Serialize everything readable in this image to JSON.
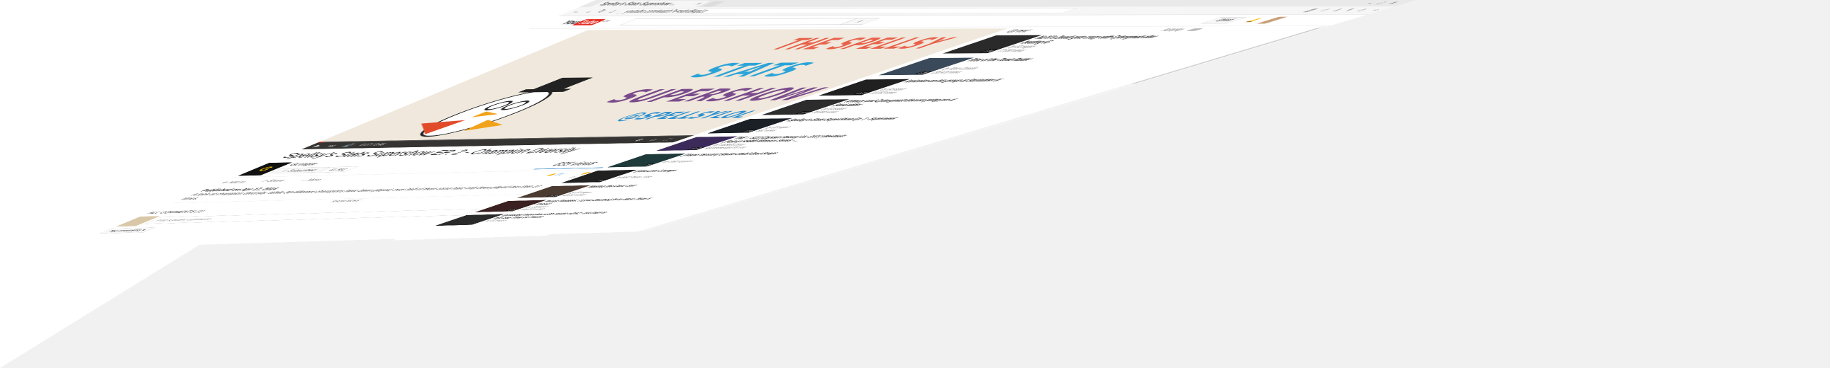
{
  "browser": {
    "tab_title": "Spellsy's Stats Supershow ...",
    "tab_close": "×",
    "url": "youtube.com/watch?v=sdrc8kqaLe"
  },
  "youtube": {
    "logo_you": "You",
    "logo_tube": "Tube",
    "logo_sup": "CA",
    "upload_label": "Upload"
  },
  "video": {
    "artwork": {
      "line1": "THE SPELLSY",
      "line2": "STATS",
      "line3": "SUPERSHOW",
      "handle": "@SPELLSYLOL"
    },
    "time": "0:17 / 3:45",
    "title": "Spellsy's Stats Supershow EP. 2 - Champion Diversity",
    "channel": "GLeague",
    "channel_logo": "G",
    "subscribed_label": "✓ Subscribed",
    "sub_count": "41,582",
    "views": "835 views",
    "add_to": "Add to",
    "share": "Share",
    "more": "More",
    "likes": "21",
    "dislikes": "0",
    "published": "Published on Apr 17, 2014",
    "description": "A look at champion diversity. While 96 different champions have been played, over half of them come have only been played less than 10 times.",
    "show_more": "SHOW MORE"
  },
  "comments": {
    "header": "ALL COMMENTS (1)",
    "placeholder": "Add a public comment...",
    "sort_label": "Top comments"
  },
  "sidebar": {
    "up_next": "Up next",
    "autoplay": "Autoplay",
    "items": [
      {
        "title": "Na'Vi's Dendi gets crazy with Cyborgmatt after beating iG",
        "channel": "by GLeague",
        "views": "77,659 views",
        "duration": "1:04",
        "color": "#2a2a2a"
      },
      {
        "title": "Rise of the Tomb Raider",
        "channel": "by Xbox Canada",
        "views": "195,418 views",
        "duration": "1:36",
        "color": "#3a4a5a"
      },
      {
        "title": "Iceiceice on his group at Starladder IX",
        "channel": "by GLeague",
        "views": "13,063 views",
        "duration": "1:25",
        "color": "#202020"
      },
      {
        "title": "Arteezy and Cyborgmatt discuss going pro at StarLadder",
        "channel": "by GLeague",
        "views": "20,890 views",
        "duration": "1:23",
        "color": "#2c2c2c"
      },
      {
        "title": "Spellsy's Stats SuperShow Ep. 1 - Superweek",
        "channel": "by GLeague",
        "views": "592 views",
        "duration": "1:59",
        "color": "#1b1f26"
      },
      {
        "title": "TNE :: S2J (Captain Falcon) Vs. OXY | Westballz (Falco) SSBM Winners Semis - ...",
        "channel": "by VGBootCamp",
        "views": "Recommended for you",
        "duration": "10:47",
        "color": "#3b2a5a"
      },
      {
        "title": "[Piano Version] Studio Ghibli Best Songs",
        "channel": "by chikh nguyen",
        "views": "",
        "duration": "23",
        "color": "#1e3a3a"
      },
      {
        "title": "1Xtra Live Lounge",
        "channel": "by BBC Radio 1Xtra",
        "views": "",
        "duration": "80",
        "color": "#202020"
      },
      {
        "title": "Making the Cast: Jatt",
        "channel": "by GLeague",
        "views": "49,558 views",
        "duration": "34:38",
        "color": "#4a3a30"
      },
      {
        "title": "Fnatic Rekkles: I Love DoubleLift As More Than A Friend",
        "channel": "by GLeague",
        "views": "131,218 views",
        "duration": "6:48",
        "color": "#3a2020"
      },
      {
        "title": "Extended Interview with Fnatic sOAZ - his Path to Pro and Time on Fnatic",
        "channel": "by GLeague",
        "views": "",
        "duration": "",
        "color": "#2a2a2a"
      }
    ]
  }
}
